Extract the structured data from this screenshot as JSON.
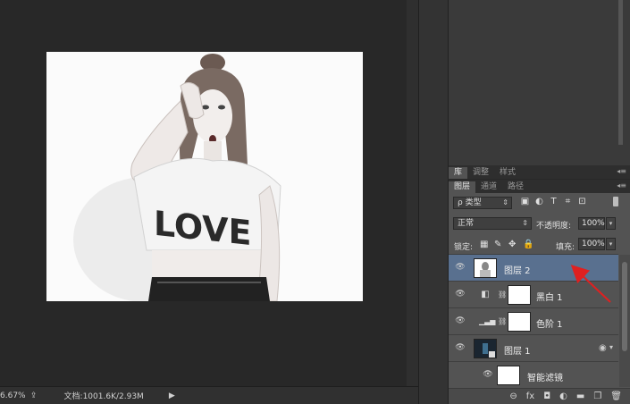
{
  "status": {
    "zoom": "6.67%",
    "doc_info": "文档:1001.6K/2.93M"
  },
  "image": {
    "word": "LOVE"
  },
  "upper_tabs": [
    "库",
    "调整",
    "样式"
  ],
  "panel_tabs": [
    "图层",
    "通道",
    "路径"
  ],
  "filter": {
    "kind": "ρ 类型"
  },
  "blend": {
    "mode": "正常",
    "opacity_label": "不透明度:",
    "opacity": "100%"
  },
  "lock": {
    "label": "锁定:",
    "fill_label": "填充:",
    "fill": "100%"
  },
  "layers": [
    {
      "name": "图层 2",
      "selected": true
    },
    {
      "name": "黑白 1",
      "selected": false
    },
    {
      "name": "色阶 1",
      "selected": false
    },
    {
      "name": "图层 1",
      "selected": false
    },
    {
      "name": "智能滤镜",
      "selected": false
    }
  ],
  "icons": {
    "eye": "eye-icon",
    "chain": "link-icon",
    "menu": "panel-menu-icon",
    "footer": [
      "link-layers-icon",
      "fx-icon",
      "mask-icon",
      "adjustment-icon",
      "group-folder-icon",
      "new-layer-icon",
      "trash-icon"
    ]
  },
  "footer_glyphs": [
    "⊖",
    "fx",
    "◘",
    "◐",
    "▬",
    "❐",
    "🗑"
  ],
  "colors": {
    "selected_layer": "#59708f",
    "annotation_arrow": "#e02020"
  }
}
